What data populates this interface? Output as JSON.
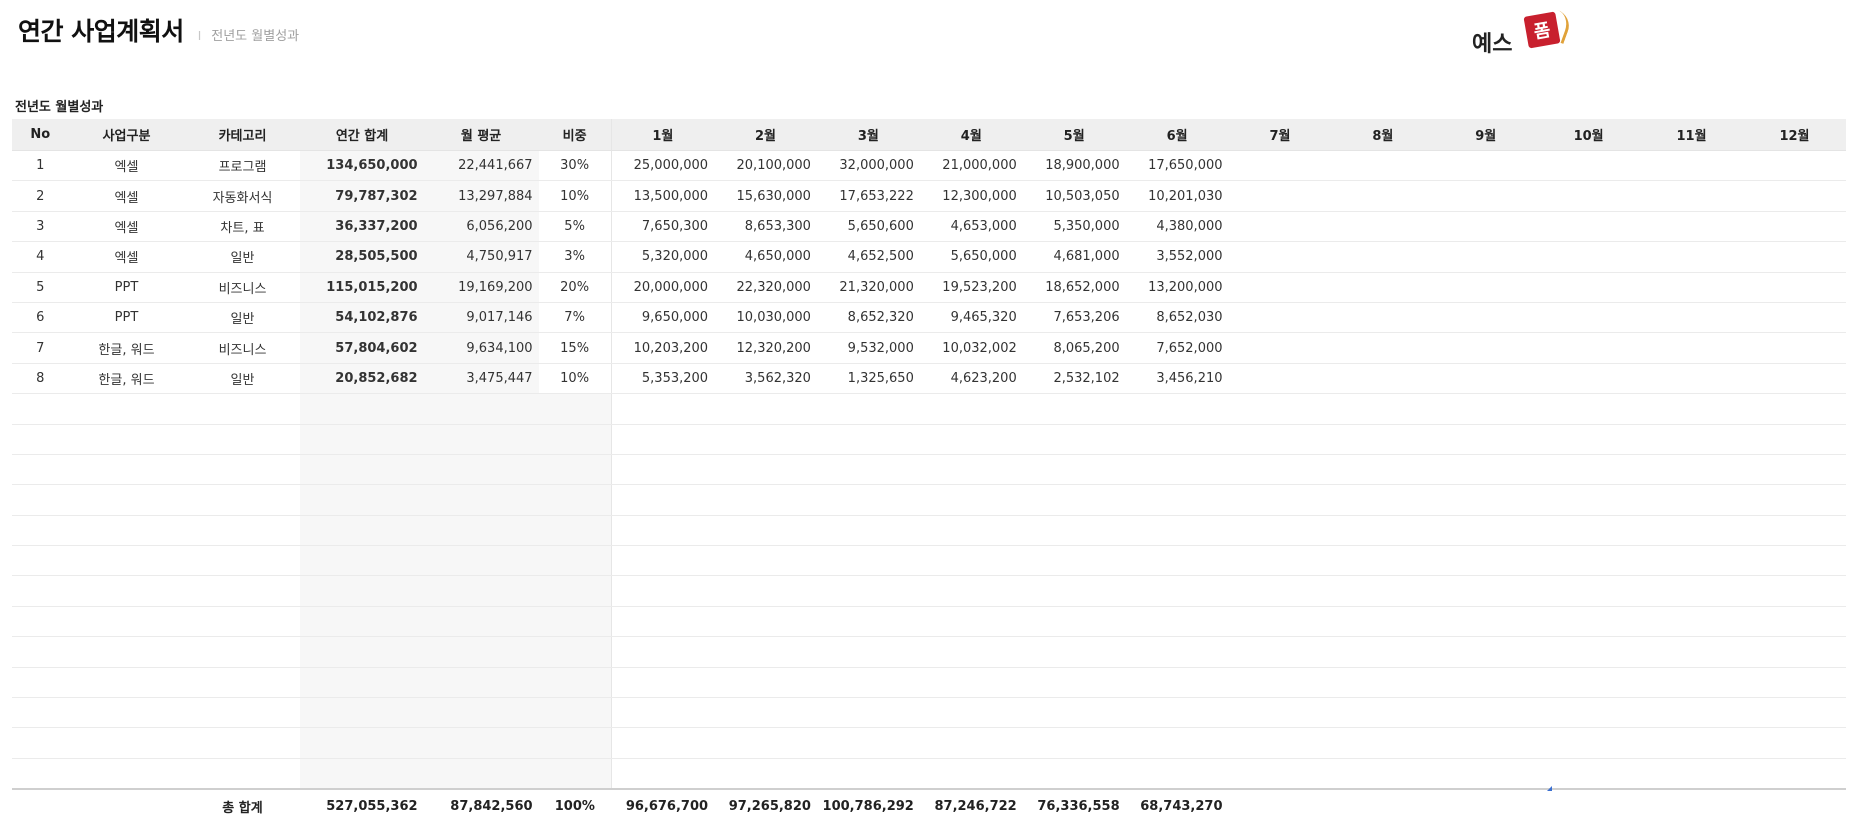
{
  "header": {
    "title": "연간 사업계획서",
    "separator": "I",
    "subtitle": "전년도 월별성과"
  },
  "logo": {
    "text": "예스",
    "badge": "폼"
  },
  "section_label": "전년도 월별성과",
  "table": {
    "columns": [
      "No",
      "사업구분",
      "카테고리",
      "연간 합계",
      "월 평균",
      "비중",
      "1월",
      "2월",
      "3월",
      "4월",
      "5월",
      "6월",
      "7월",
      "8월",
      "9월",
      "10월",
      "11월",
      "12월"
    ],
    "rows": [
      {
        "no": "1",
        "division": "엑셀",
        "category": "프로그램",
        "total": "134,650,000",
        "avg": "22,441,667",
        "ratio": "30%",
        "months": [
          "25,000,000",
          "20,100,000",
          "32,000,000",
          "21,000,000",
          "18,900,000",
          "17,650,000",
          "",
          "",
          "",
          "",
          "",
          ""
        ]
      },
      {
        "no": "2",
        "division": "엑셀",
        "category": "자동화서식",
        "total": "79,787,302",
        "avg": "13,297,884",
        "ratio": "10%",
        "months": [
          "13,500,000",
          "15,630,000",
          "17,653,222",
          "12,300,000",
          "10,503,050",
          "10,201,030",
          "",
          "",
          "",
          "",
          "",
          ""
        ]
      },
      {
        "no": "3",
        "division": "엑셀",
        "category": "차트, 표",
        "total": "36,337,200",
        "avg": "6,056,200",
        "ratio": "5%",
        "months": [
          "7,650,300",
          "8,653,300",
          "5,650,600",
          "4,653,000",
          "5,350,000",
          "4,380,000",
          "",
          "",
          "",
          "",
          "",
          ""
        ]
      },
      {
        "no": "4",
        "division": "엑셀",
        "category": "일반",
        "total": "28,505,500",
        "avg": "4,750,917",
        "ratio": "3%",
        "months": [
          "5,320,000",
          "4,650,000",
          "4,652,500",
          "5,650,000",
          "4,681,000",
          "3,552,000",
          "",
          "",
          "",
          "",
          "",
          ""
        ]
      },
      {
        "no": "5",
        "division": "PPT",
        "category": "비즈니스",
        "total": "115,015,200",
        "avg": "19,169,200",
        "ratio": "20%",
        "months": [
          "20,000,000",
          "22,320,000",
          "21,320,000",
          "19,523,200",
          "18,652,000",
          "13,200,000",
          "",
          "",
          "",
          "",
          "",
          ""
        ]
      },
      {
        "no": "6",
        "division": "PPT",
        "category": "일반",
        "total": "54,102,876",
        "avg": "9,017,146",
        "ratio": "7%",
        "months": [
          "9,650,000",
          "10,030,000",
          "8,652,320",
          "9,465,320",
          "7,653,206",
          "8,652,030",
          "",
          "",
          "",
          "",
          "",
          ""
        ]
      },
      {
        "no": "7",
        "division": "한글, 워드",
        "category": "비즈니스",
        "total": "57,804,602",
        "avg": "9,634,100",
        "ratio": "15%",
        "months": [
          "10,203,200",
          "12,320,200",
          "9,532,000",
          "10,032,002",
          "8,065,200",
          "7,652,000",
          "",
          "",
          "",
          "",
          "",
          ""
        ]
      },
      {
        "no": "8",
        "division": "한글, 워드",
        "category": "일반",
        "total": "20,852,682",
        "avg": "3,475,447",
        "ratio": "10%",
        "months": [
          "5,353,200",
          "3,562,320",
          "1,325,650",
          "4,623,200",
          "2,532,102",
          "3,456,210",
          "",
          "",
          "",
          "",
          "",
          ""
        ]
      }
    ],
    "empty_row_count": 13,
    "footer": {
      "label": "총 합계",
      "total": "527,055,362",
      "avg": "87,842,560",
      "ratio": "100%",
      "months": [
        "96,676,700",
        "97,265,820",
        "100,786,292",
        "87,246,722",
        "76,336,558",
        "68,743,270",
        "",
        "",
        "",
        "",
        "",
        ""
      ]
    }
  }
}
